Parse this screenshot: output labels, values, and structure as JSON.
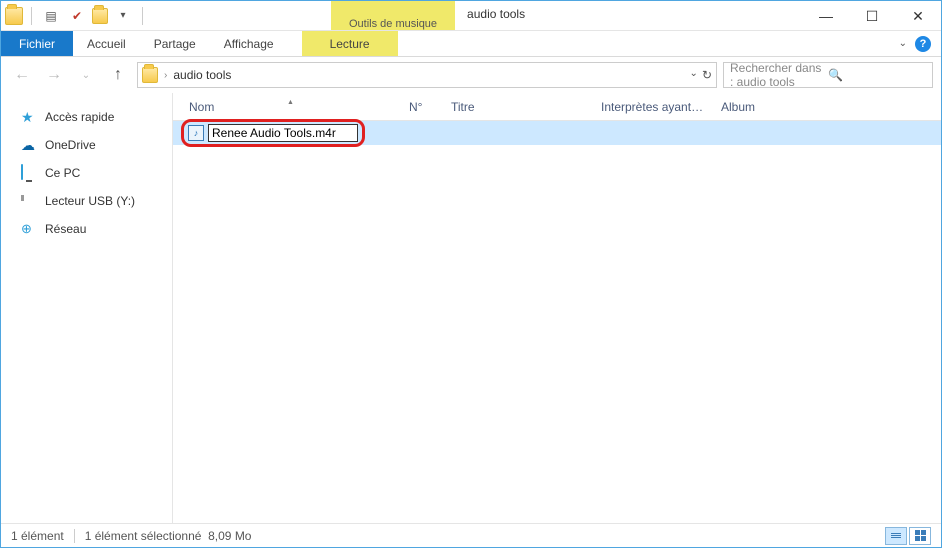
{
  "title": "audio tools",
  "music_tab": "Outils de musique",
  "ribbon": {
    "file": "Fichier",
    "home": "Accueil",
    "share": "Partage",
    "view": "Affichage",
    "play": "Lecture"
  },
  "address": {
    "folder": "audio tools"
  },
  "search": {
    "placeholder": "Rechercher dans : audio tools"
  },
  "sidebar": {
    "quick": "Accès rapide",
    "onedrive": "OneDrive",
    "pc": "Ce PC",
    "usb": "Lecteur USB (Y:)",
    "network": "Réseau"
  },
  "columns": {
    "name": "Nom",
    "no": "N°",
    "title": "Titre",
    "artists": "Interprètes ayant p...",
    "album": "Album"
  },
  "file": {
    "rename_value": "Renee Audio Tools.m4r"
  },
  "status": {
    "count": "1 élément",
    "selection": "1 élément sélectionné",
    "size": "8,09 Mo"
  }
}
